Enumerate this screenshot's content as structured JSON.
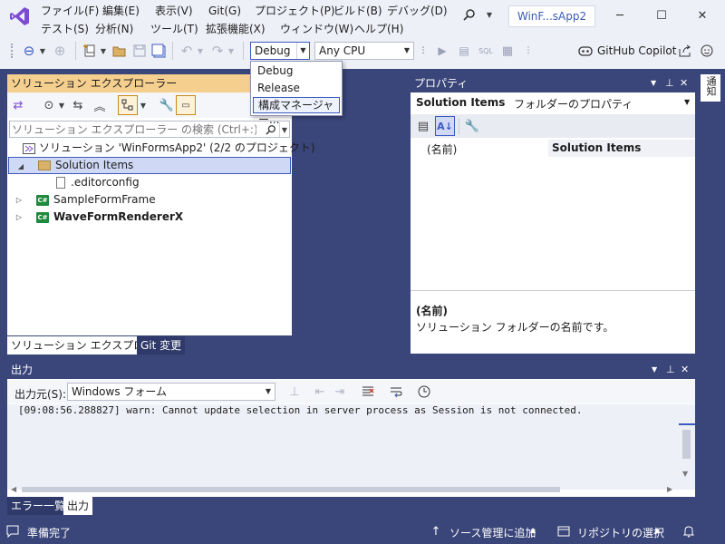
{
  "menubar": {
    "items": [
      "ファイル(F)",
      "編集(E)",
      "表示(V)",
      "Git(G)",
      "プロジェクト(P)",
      "ビルド(B)",
      "デバッグ(D)",
      "テスト(S)",
      "分析(N)",
      "ツール(T)",
      "拡張機能(X)",
      "ウィンドウ(W)",
      "ヘルプ(H)"
    ],
    "window_title": "WinF...sApp2"
  },
  "toolbar": {
    "config_combo": "Debug",
    "platform_combo": "Any CPU",
    "copilot_label": "GitHub Copilot"
  },
  "config_dropdown": {
    "items": [
      "Debug",
      "Release",
      "構成マネージャー..."
    ]
  },
  "solution_explorer": {
    "title": "ソリューション エクスプローラー",
    "search_placeholder": "ソリューション エクスプローラー の検索 (Ctrl+:)",
    "solution_label": "ソリューション 'WinFormsApp2' (2/2 のプロジェクト)",
    "items": [
      {
        "label": "Solution Items",
        "kind": "folder",
        "expanded": true,
        "selected": true
      },
      {
        "label": ".editorconfig",
        "kind": "file"
      },
      {
        "label": "SampleFormFrame",
        "kind": "csproj"
      },
      {
        "label": "WaveFormRendererX",
        "kind": "csproj",
        "bold": true
      }
    ],
    "tabs": [
      "ソリューション エクスプローラー",
      "Git 変更"
    ]
  },
  "properties": {
    "title": "プロパティ",
    "object_name": "Solution Items",
    "object_desc": "フォルダーのプロパティ",
    "rows": [
      {
        "name": "(名前)",
        "value": "Solution Items"
      }
    ],
    "desc_title": "(名前)",
    "desc_text": "ソリューション フォルダーの名前です。",
    "side_tab": "通知"
  },
  "output": {
    "title": "出力",
    "source_label": "出力元(S):",
    "source_value": "Windows フォーム",
    "log_line": "[09:08:56.288827] warn: Cannot update selection in server process as Session is not connected.",
    "tabs": [
      "エラー一覧",
      "出力"
    ]
  },
  "statusbar": {
    "ready": "準備完了",
    "source_control": "ソース管理に追加",
    "repo_select": "リポジトリの選択"
  },
  "colors": {
    "accent": "#3a4579",
    "se_header": "#f5cf8e",
    "vs_logo": "#7b4bd1"
  }
}
